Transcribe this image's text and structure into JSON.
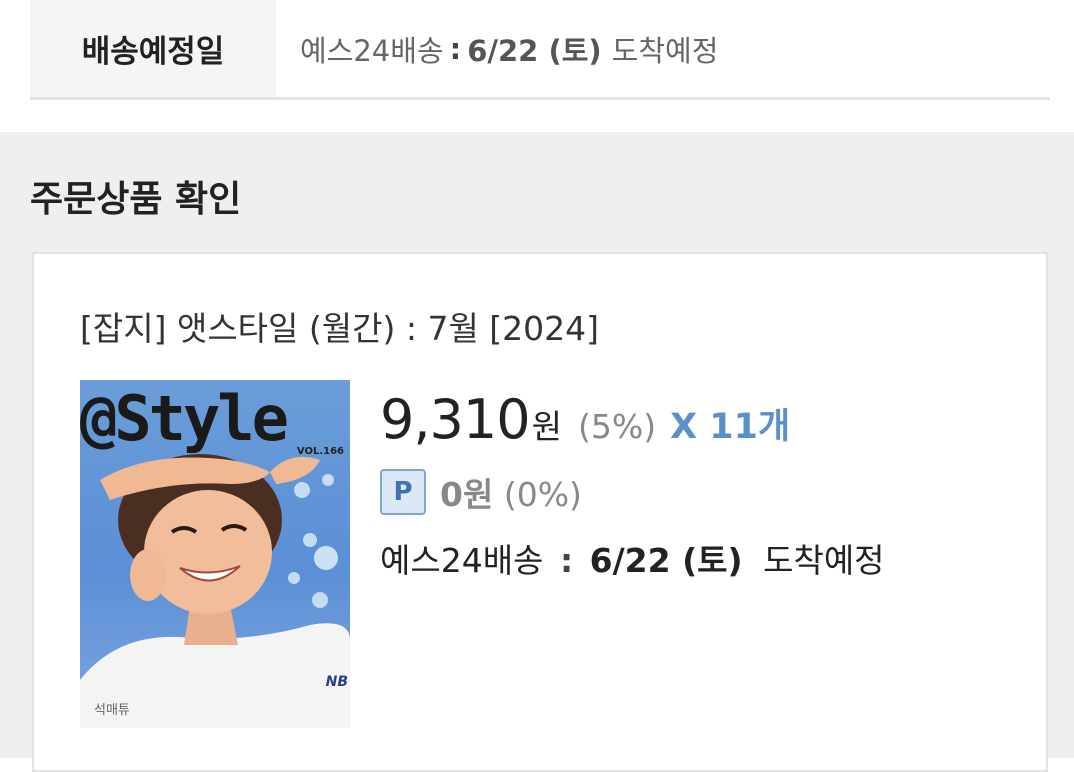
{
  "delivery": {
    "label": "배송예정일",
    "carrier": "예스24배송",
    "separator": ":",
    "date": "6/22 (토)",
    "suffix": "도착예정"
  },
  "order": {
    "section_title": "주문상품 확인",
    "product": {
      "title": "[잡지] 앳스타일 (월간) : 7월 [2024]",
      "cover": {
        "logo": "@Style",
        "vol": "VOL.166",
        "name": "석매튜",
        "brand": "NB"
      },
      "price": "9,310",
      "price_unit": "원",
      "discount": "(5%)",
      "quantity": "X 11개",
      "point_badge": "P",
      "point_amount": "0원",
      "point_rate": "(0%)",
      "shipping": {
        "carrier": "예스24배송",
        "separator": ":",
        "date": "6/22 (토)",
        "suffix": "도착예정"
      }
    }
  },
  "colors": {
    "accent": "#5a8fc9",
    "section_bg": "#efefef",
    "label_bg": "#f5f5f5"
  }
}
